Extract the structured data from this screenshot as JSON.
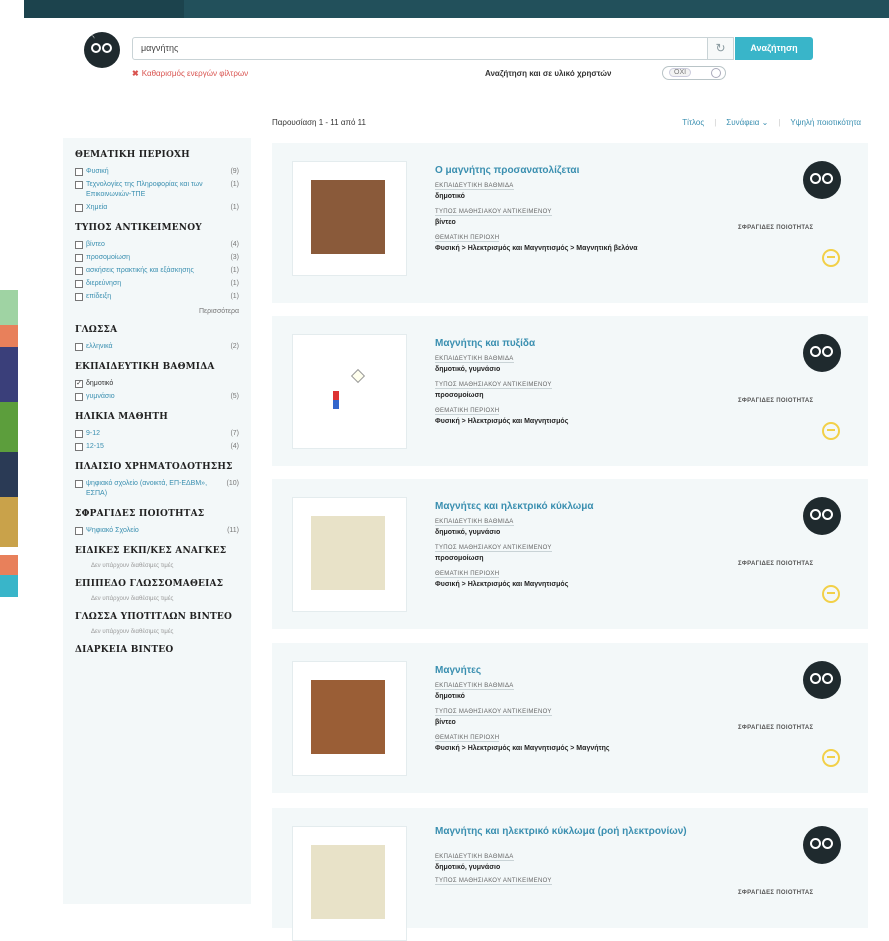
{
  "header": {
    "search_value": "μαγνήτης",
    "search_button": "Αναζήτηση",
    "refresh_icon": "↻",
    "clear_filters": "Καθαρισμός ενεργών φίλτρων",
    "toggle_label": "Αναζήτηση και σε υλικό χρηστών",
    "toggle_state": "ΟΧΙ"
  },
  "results": {
    "count_text": "Παρουσίαση 1 - 11 από 11",
    "sort_title": "Τίτλος",
    "sort_relevance": "Συνάφεια ⌄",
    "sort_quality": "Υψηλή ποιοτικότητα"
  },
  "sidebar": {
    "facets": [
      {
        "title": "ΘΕΜΑΤΙΚΗ ΠΕΡΙΟΧΗ",
        "items": [
          {
            "label": "Φυσική",
            "count": "(9)"
          },
          {
            "label": "Τεχνολογίες της Πληροφορίας και των Επικοινωνιών-ΤΠΕ",
            "count": "(1)"
          },
          {
            "label": "Χημεία",
            "count": "(1)"
          }
        ]
      },
      {
        "title": "ΤΥΠΟΣ ΑΝΤΙΚΕΙΜΕΝΟΥ",
        "items": [
          {
            "label": "βίντεο",
            "count": "(4)"
          },
          {
            "label": "προσομοίωση",
            "count": "(3)"
          },
          {
            "label": "ασκήσεις πρακτικής και εξάσκησης",
            "count": "(1)"
          },
          {
            "label": "διερεύνηση",
            "count": "(1)"
          },
          {
            "label": "επίδειξη",
            "count": "(1)"
          }
        ],
        "more": "Περισσότερα"
      },
      {
        "title": "ΓΛΩΣΣΑ",
        "items": [
          {
            "label": "ελληνικά",
            "count": "(2)"
          }
        ]
      },
      {
        "title": "ΕΚΠΑΙΔΕΥΤΙΚΗ ΒΑΘΜΙΔΑ",
        "items": [
          {
            "label": "δημοτικό",
            "count": "",
            "checked": true
          },
          {
            "label": "γυμνάσιο",
            "count": "(5)"
          }
        ]
      },
      {
        "title": "ΗΛΙΚΙΑ ΜΑΘΗΤΗ",
        "items": [
          {
            "label": "9-12",
            "count": "(7)"
          },
          {
            "label": "12-15",
            "count": "(4)"
          }
        ]
      },
      {
        "title": "ΠΛΑΙΣΙΟ ΧΡΗΜΑΤΟΔΟΤΗΣΗΣ",
        "items": [
          {
            "label": "ψηφιακό σχολείο (ανοικτά, ΕΠ-ΕΔΒΜ», ΕΣΠΑ)",
            "count": "(10)"
          }
        ]
      },
      {
        "title": "ΣΦΡΑΓΙΔΕΣ ΠΟΙΟΤΗΤΑΣ",
        "items": [
          {
            "label": "Ψηφιακό Σχολείο",
            "count": "(11)"
          }
        ]
      },
      {
        "title": "ΕΙΔΙΚΕΣ ΕΚΠ/ΚΕΣ ΑΝΑΓΚΕΣ",
        "empty": "Δεν υπάρχουν διαθέσιμες τιμές"
      },
      {
        "title": "ΕΠΙΠΕΔΟ ΓΛΩΣΣΟΜΑΘΕΙΑΣ",
        "empty": "Δεν υπάρχουν διαθέσιμες τιμές"
      },
      {
        "title": "ΓΛΩΣΣΑ ΥΠΟΤΙΤΛΩΝ ΒΙΝΤΕΟ",
        "empty": "Δεν υπάρχουν διαθέσιμες τιμές"
      },
      {
        "title": "ΔΙΑΡΚΕΙΑ ΒΙΝΤΕΟ"
      }
    ]
  },
  "cards": [
    {
      "title": "Ο μαγνήτης προσανατολίζεται",
      "level_label": "ΕΚΠΑΙΔΕΥΤΙΚΗ ΒΑΘΜΙΔΑ",
      "level": "δημοτικό",
      "type_label": "ΤΥΠΟΣ ΜΑΘΗΣΙΑΚΟΥ ΑΝΤΙΚΕΙΜΕΝΟΥ",
      "type": "βίντεο",
      "area_label": "ΘΕΜΑΤΙΚΗ ΠΕΡΙΟΧΗ",
      "area": "Φυσική > Ηλεκτρισμός και Μαγνητισμός > Μαγνητική βελόνα",
      "quality": "ΣΦΡΑΓΙΔΕΣ ΠΟΙΟΤΗΤΑΣ"
    },
    {
      "title": "Μαγνήτης και πυξίδα",
      "level_label": "ΕΚΠΑΙΔΕΥΤΙΚΗ ΒΑΘΜΙΔΑ",
      "level": "δημοτικό, γυμνάσιο",
      "type_label": "ΤΥΠΟΣ ΜΑΘΗΣΙΑΚΟΥ ΑΝΤΙΚΕΙΜΕΝΟΥ",
      "type": "προσομοίωση",
      "area_label": "ΘΕΜΑΤΙΚΗ ΠΕΡΙΟΧΗ",
      "area": "Φυσική > Ηλεκτρισμός και Μαγνητισμός",
      "quality": "ΣΦΡΑΓΙΔΕΣ ΠΟΙΟΤΗΤΑΣ"
    },
    {
      "title": "Μαγνήτες και ηλεκτρικό κύκλωμα",
      "level_label": "ΕΚΠΑΙΔΕΥΤΙΚΗ ΒΑΘΜΙΔΑ",
      "level": "δημοτικό, γυμνάσιο",
      "type_label": "ΤΥΠΟΣ ΜΑΘΗΣΙΑΚΟΥ ΑΝΤΙΚΕΙΜΕΝΟΥ",
      "type": "προσομοίωση",
      "area_label": "ΘΕΜΑΤΙΚΗ ΠΕΡΙΟΧΗ",
      "area": "Φυσική > Ηλεκτρισμός και Μαγνητισμός",
      "quality": "ΣΦΡΑΓΙΔΕΣ ΠΟΙΟΤΗΤΑΣ"
    },
    {
      "title": "Μαγνήτες",
      "level_label": "ΕΚΠΑΙΔΕΥΤΙΚΗ ΒΑΘΜΙΔΑ",
      "level": "δημοτικό",
      "type_label": "ΤΥΠΟΣ ΜΑΘΗΣΙΑΚΟΥ ΑΝΤΙΚΕΙΜΕΝΟΥ",
      "type": "βίντεο",
      "area_label": "ΘΕΜΑΤΙΚΗ ΠΕΡΙΟΧΗ",
      "area": "Φυσική > Ηλεκτρισμός και Μαγνητισμός > Μαγνήτης",
      "quality": "ΣΦΡΑΓΙΔΕΣ ΠΟΙΟΤΗΤΑΣ"
    },
    {
      "title": "Μαγνήτης και ηλεκτρικό κύκλωμα (ροή ηλεκτρονίων)",
      "level_label": "ΕΚΠΑΙΔΕΥΤΙΚΗ ΒΑΘΜΙΔΑ",
      "level": "δημοτικό, γυμνάσιο",
      "type_label": "ΤΥΠΟΣ ΜΑΘΗΣΙΑΚΟΥ ΑΝΤΙΚΕΙΜΕΝΟΥ",
      "type": "",
      "area_label": "",
      "area": "",
      "quality": "ΣΦΡΑΓΙΔΕΣ ΠΟΙΟΤΗΤΑΣ"
    }
  ],
  "colors": {
    "topbar": "#22505b",
    "accent": "#39b5c9",
    "link": "#3a8fb0",
    "panel": "#f3f8f9",
    "clear": "#d9534f",
    "seal": "#f2d048"
  }
}
